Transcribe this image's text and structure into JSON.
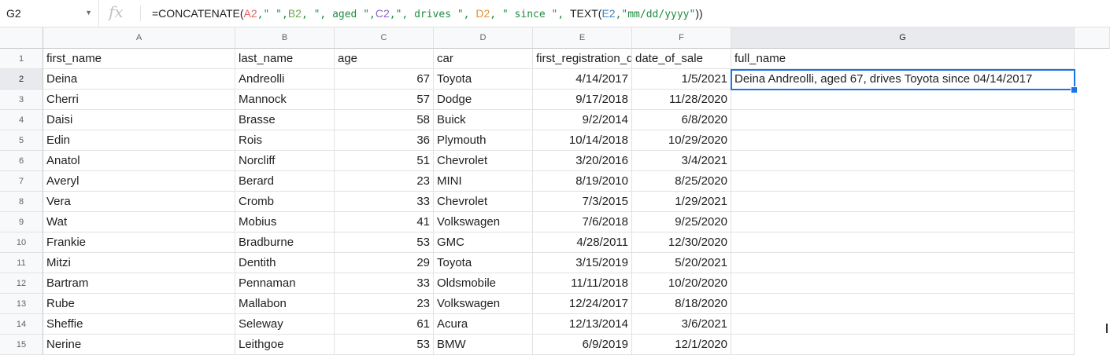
{
  "formula_bar": {
    "cell_ref": "G2",
    "fx_label": "fx",
    "formula_parts": [
      {
        "t": "=CONCATENATE(",
        "c": ""
      },
      {
        "t": "A2",
        "c": "r1"
      },
      {
        "t": ",\" \",",
        "c": "str"
      },
      {
        "t": "B2",
        "c": "r2"
      },
      {
        "t": ", \", aged \",",
        "c": "str"
      },
      {
        "t": "C2",
        "c": "r3"
      },
      {
        "t": ",\", drives \", ",
        "c": "str"
      },
      {
        "t": "D2",
        "c": "r4"
      },
      {
        "t": ", \" since \", ",
        "c": "str"
      },
      {
        "t": "TEXT(",
        "c": ""
      },
      {
        "t": "E2",
        "c": "r5"
      },
      {
        "t": ",\"mm/dd/yyyy\"",
        "c": "str"
      },
      {
        "t": "))",
        "c": ""
      }
    ]
  },
  "columns": [
    "A",
    "B",
    "C",
    "D",
    "E",
    "F",
    "G"
  ],
  "active_column": "G",
  "active_row": "2",
  "header_row": [
    "first_name",
    "last_name",
    "age",
    "car",
    "first_registration_date",
    "date_of_sale",
    "full_name"
  ],
  "rows": [
    [
      "Deina",
      "Andreolli",
      "67",
      "Toyota",
      "4/14/2017",
      "1/5/2021",
      "Deina Andreolli, aged 67, drives Toyota since 04/14/2017"
    ],
    [
      "Cherri",
      "Mannock",
      "57",
      "Dodge",
      "9/17/2018",
      "11/28/2020",
      ""
    ],
    [
      "Daisi",
      "Brasse",
      "58",
      "Buick",
      "9/2/2014",
      "6/8/2020",
      ""
    ],
    [
      "Edin",
      "Rois",
      "36",
      "Plymouth",
      "10/14/2018",
      "10/29/2020",
      ""
    ],
    [
      "Anatol",
      "Norcliff",
      "51",
      "Chevrolet",
      "3/20/2016",
      "3/4/2021",
      ""
    ],
    [
      "Averyl",
      "Berard",
      "23",
      "MINI",
      "8/19/2010",
      "8/25/2020",
      ""
    ],
    [
      "Vera",
      "Cromb",
      "33",
      "Chevrolet",
      "7/3/2015",
      "1/29/2021",
      ""
    ],
    [
      "Wat",
      "Mobius",
      "41",
      "Volkswagen",
      "7/6/2018",
      "9/25/2020",
      ""
    ],
    [
      "Frankie",
      "Bradburne",
      "53",
      "GMC",
      "4/28/2011",
      "12/30/2020",
      ""
    ],
    [
      "Mitzi",
      "Dentith",
      "29",
      "Toyota",
      "3/15/2019",
      "5/20/2021",
      ""
    ],
    [
      "Bartram",
      "Pennaman",
      "33",
      "Oldsmobile",
      "11/11/2018",
      "10/20/2020",
      ""
    ],
    [
      "Rube",
      "Mallabon",
      "23",
      "Volkswagen",
      "12/24/2017",
      "8/18/2020",
      ""
    ],
    [
      "Sheffie",
      "Seleway",
      "61",
      "Acura",
      "12/13/2014",
      "3/6/2021",
      ""
    ],
    [
      "Nerine",
      "Leithgoe",
      "53",
      "BMW",
      "6/9/2019",
      "12/1/2020",
      ""
    ]
  ]
}
